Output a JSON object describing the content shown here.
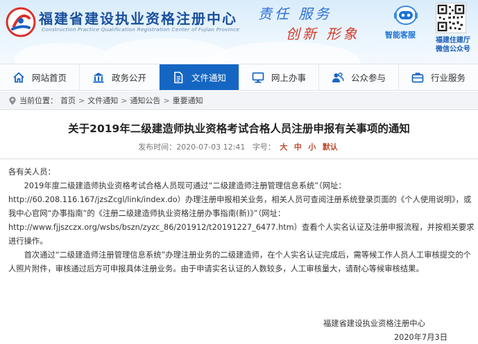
{
  "header": {
    "site_name": "福建省建设执业资格注册中心",
    "site_name_en": "Construction Practice Qualification Registration Center of Fujian Province",
    "slogan_line1": "责任 服务",
    "slogan_line2": "创新 形象",
    "service_label": "智能客服",
    "qr_label_line1": "福建住建厅",
    "qr_label_line2": "微信公众号"
  },
  "nav": {
    "items": [
      {
        "label": "网站首页",
        "icon": "home-icon"
      },
      {
        "label": "政务公开",
        "icon": "government-icon"
      },
      {
        "label": "文件通知",
        "icon": "document-icon",
        "active": true
      },
      {
        "label": "网上办事",
        "icon": "computer-icon"
      },
      {
        "label": "公众参与",
        "icon": "people-icon"
      },
      {
        "label": "行业服务",
        "icon": "briefcase-icon"
      }
    ]
  },
  "breadcrumb": {
    "prefix": "当前位置：",
    "items": [
      "首页",
      "文件通知",
      "通知公告",
      "重要通知"
    ],
    "separator": ">"
  },
  "article": {
    "title": "关于2019年二级建造师执业资格考试合格人员注册申报有关事项的通知",
    "publish_label": "发布时间：",
    "publish_time": "2020-07-03 12:41",
    "font_label": "字号：",
    "font_large": "大",
    "font_medium": "中",
    "font_small": "小",
    "font_default": "默认",
    "greeting": "各有关人员：",
    "para1_a": "2019年度二级建造师执业资格考试合格人员现可通过“二级建造师注册管理信息系统”（网址：",
    "para1_url1": "http://60.208.116.167/jzsZcgl/link/index.do",
    "para1_b": "）办理注册申报相关业务，相关人员可查阅注册系统登录页面的《个人使用说明》，或我中心官网“办事指南”的《注册二级建造师执业资格注册办事指南(新)》”（网址：",
    "para1_url2": "http://www.fjjszczx.org/wsbs/bszn/zyzc_86/201912/t20191227_6477.htm",
    "para1_c": "）查看个人实名认证及注册申报流程，并按相关要求进行操作。",
    "para2": "首次通过“二级建造师注册管理信息系统”办理注册业务的二级建造师，在个人实名认证完成后，需等候工作人员人工审核提交的个人照片附件，审核通过后方可申报具体注册业务。由于申请实名认证的人数较多，人工审核量大，请耐心等候审核结果。",
    "signature_org": "福建省建设执业资格注册中心",
    "signature_date": "2020年7月3日"
  },
  "colors": {
    "nav_active": "#1566c2",
    "site_name": "#1a4f9c",
    "slogan_blue": "#2f6fd6",
    "slogan_red": "#d23a2b"
  }
}
